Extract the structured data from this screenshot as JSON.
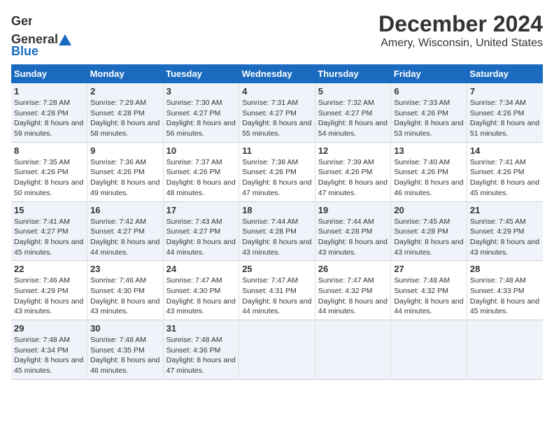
{
  "header": {
    "logo_general": "General",
    "logo_blue": "Blue",
    "title": "December 2024",
    "subtitle": "Amery, Wisconsin, United States"
  },
  "columns": [
    "Sunday",
    "Monday",
    "Tuesday",
    "Wednesday",
    "Thursday",
    "Friday",
    "Saturday"
  ],
  "weeks": [
    [
      {
        "day": "1",
        "sunrise": "7:28 AM",
        "sunset": "4:28 PM",
        "daylight": "8 hours and 59 minutes."
      },
      {
        "day": "2",
        "sunrise": "7:29 AM",
        "sunset": "4:28 PM",
        "daylight": "8 hours and 58 minutes."
      },
      {
        "day": "3",
        "sunrise": "7:30 AM",
        "sunset": "4:27 PM",
        "daylight": "8 hours and 56 minutes."
      },
      {
        "day": "4",
        "sunrise": "7:31 AM",
        "sunset": "4:27 PM",
        "daylight": "8 hours and 55 minutes."
      },
      {
        "day": "5",
        "sunrise": "7:32 AM",
        "sunset": "4:27 PM",
        "daylight": "8 hours and 54 minutes."
      },
      {
        "day": "6",
        "sunrise": "7:33 AM",
        "sunset": "4:26 PM",
        "daylight": "8 hours and 53 minutes."
      },
      {
        "day": "7",
        "sunrise": "7:34 AM",
        "sunset": "4:26 PM",
        "daylight": "8 hours and 51 minutes."
      }
    ],
    [
      {
        "day": "8",
        "sunrise": "7:35 AM",
        "sunset": "4:26 PM",
        "daylight": "8 hours and 50 minutes."
      },
      {
        "day": "9",
        "sunrise": "7:36 AM",
        "sunset": "4:26 PM",
        "daylight": "8 hours and 49 minutes."
      },
      {
        "day": "10",
        "sunrise": "7:37 AM",
        "sunset": "4:26 PM",
        "daylight": "8 hours and 48 minutes."
      },
      {
        "day": "11",
        "sunrise": "7:38 AM",
        "sunset": "4:26 PM",
        "daylight": "8 hours and 47 minutes."
      },
      {
        "day": "12",
        "sunrise": "7:39 AM",
        "sunset": "4:26 PM",
        "daylight": "8 hours and 47 minutes."
      },
      {
        "day": "13",
        "sunrise": "7:40 AM",
        "sunset": "4:26 PM",
        "daylight": "8 hours and 46 minutes."
      },
      {
        "day": "14",
        "sunrise": "7:41 AM",
        "sunset": "4:26 PM",
        "daylight": "8 hours and 45 minutes."
      }
    ],
    [
      {
        "day": "15",
        "sunrise": "7:41 AM",
        "sunset": "4:27 PM",
        "daylight": "8 hours and 45 minutes."
      },
      {
        "day": "16",
        "sunrise": "7:42 AM",
        "sunset": "4:27 PM",
        "daylight": "8 hours and 44 minutes."
      },
      {
        "day": "17",
        "sunrise": "7:43 AM",
        "sunset": "4:27 PM",
        "daylight": "8 hours and 44 minutes."
      },
      {
        "day": "18",
        "sunrise": "7:44 AM",
        "sunset": "4:28 PM",
        "daylight": "8 hours and 43 minutes."
      },
      {
        "day": "19",
        "sunrise": "7:44 AM",
        "sunset": "4:28 PM",
        "daylight": "8 hours and 43 minutes."
      },
      {
        "day": "20",
        "sunrise": "7:45 AM",
        "sunset": "4:28 PM",
        "daylight": "8 hours and 43 minutes."
      },
      {
        "day": "21",
        "sunrise": "7:45 AM",
        "sunset": "4:29 PM",
        "daylight": "8 hours and 43 minutes."
      }
    ],
    [
      {
        "day": "22",
        "sunrise": "7:46 AM",
        "sunset": "4:29 PM",
        "daylight": "8 hours and 43 minutes."
      },
      {
        "day": "23",
        "sunrise": "7:46 AM",
        "sunset": "4:30 PM",
        "daylight": "8 hours and 43 minutes."
      },
      {
        "day": "24",
        "sunrise": "7:47 AM",
        "sunset": "4:30 PM",
        "daylight": "8 hours and 43 minutes."
      },
      {
        "day": "25",
        "sunrise": "7:47 AM",
        "sunset": "4:31 PM",
        "daylight": "8 hours and 44 minutes."
      },
      {
        "day": "26",
        "sunrise": "7:47 AM",
        "sunset": "4:32 PM",
        "daylight": "8 hours and 44 minutes."
      },
      {
        "day": "27",
        "sunrise": "7:48 AM",
        "sunset": "4:32 PM",
        "daylight": "8 hours and 44 minutes."
      },
      {
        "day": "28",
        "sunrise": "7:48 AM",
        "sunset": "4:33 PM",
        "daylight": "8 hours and 45 minutes."
      }
    ],
    [
      {
        "day": "29",
        "sunrise": "7:48 AM",
        "sunset": "4:34 PM",
        "daylight": "8 hours and 45 minutes."
      },
      {
        "day": "30",
        "sunrise": "7:48 AM",
        "sunset": "4:35 PM",
        "daylight": "8 hours and 46 minutes."
      },
      {
        "day": "31",
        "sunrise": "7:48 AM",
        "sunset": "4:36 PM",
        "daylight": "8 hours and 47 minutes."
      },
      {
        "day": "",
        "sunrise": "",
        "sunset": "",
        "daylight": ""
      },
      {
        "day": "",
        "sunrise": "",
        "sunset": "",
        "daylight": ""
      },
      {
        "day": "",
        "sunrise": "",
        "sunset": "",
        "daylight": ""
      },
      {
        "day": "",
        "sunrise": "",
        "sunset": "",
        "daylight": ""
      }
    ]
  ],
  "labels": {
    "sunrise_label": "Sunrise:",
    "sunset_label": "Sunset:",
    "daylight_label": "Daylight:"
  }
}
